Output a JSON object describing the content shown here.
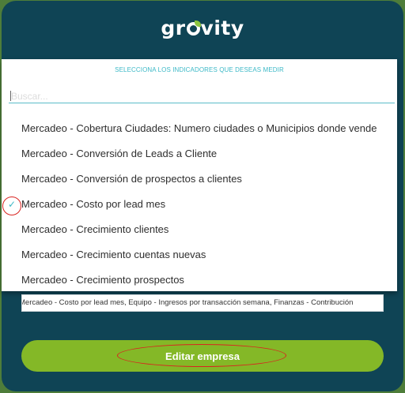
{
  "brand": {
    "logo_text_prefix": "gr",
    "logo_text_suffix": "vity"
  },
  "selector": {
    "title": "SELECCIONA LOS INDICADORES QUE DESEAS MEDIR",
    "search_placeholder": "Buscar...",
    "options": [
      {
        "label": "Mercadeo - Cobertura Ciudades: Numero ciudades o Municipios donde vende",
        "selected": false
      },
      {
        "label": "Mercadeo - Conversión de Leads a Cliente",
        "selected": false
      },
      {
        "label": "Mercadeo - Conversión de prospectos a clientes",
        "selected": false
      },
      {
        "label": "Mercadeo - Costo por lead mes",
        "selected": true,
        "check_icon": "check-icon"
      },
      {
        "label": "Mercadeo - Crecimiento clientes",
        "selected": false
      },
      {
        "label": "Mercadeo - Crecimiento cuentas nuevas",
        "selected": false
      },
      {
        "label": "Mercadeo - Crecimiento prospectos",
        "selected": false
      }
    ]
  },
  "selected_summary": "Mercadeo - Costo por lead mes, Equipo - Ingresos por transacción semana, Finanzas - Contribución",
  "actions": {
    "edit_label": "Editar empresa"
  },
  "colors": {
    "modal": "#0f4455",
    "accent": "#3db9c7",
    "button": "#84b827",
    "highlight": "#d9231f"
  }
}
